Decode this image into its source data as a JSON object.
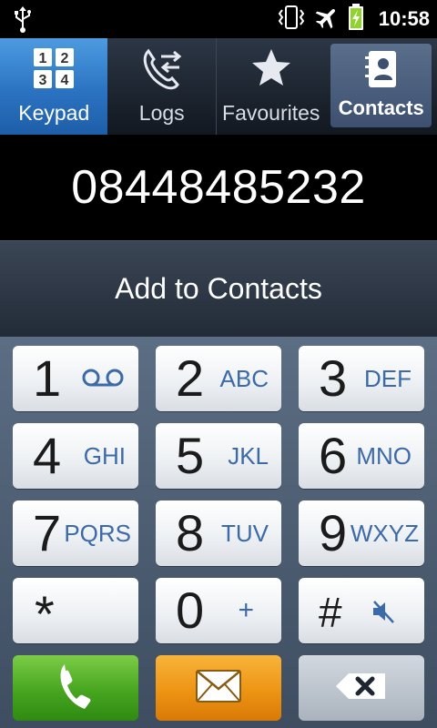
{
  "status": {
    "time": "10:58",
    "icons": [
      "usb-icon",
      "vibrate-icon",
      "airplane-icon",
      "battery-charging-icon"
    ]
  },
  "tabs": [
    {
      "label": "Keypad",
      "icon": "keypad-icon",
      "active": true
    },
    {
      "label": "Logs",
      "icon": "call-logs-icon",
      "active": false
    },
    {
      "label": "Favourites",
      "icon": "star-icon",
      "active": false
    },
    {
      "label": "Contacts",
      "icon": "contacts-icon",
      "active": false
    }
  ],
  "tab_keypad_icon_digits": [
    "1",
    "2",
    "3",
    "4"
  ],
  "dialed_number": "08448485232",
  "add_to_contacts_label": "Add to Contacts",
  "keys": [
    {
      "digit": "1",
      "letters": ""
    },
    {
      "digit": "2",
      "letters": "ABC"
    },
    {
      "digit": "3",
      "letters": "DEF"
    },
    {
      "digit": "4",
      "letters": "GHI"
    },
    {
      "digit": "5",
      "letters": "JKL"
    },
    {
      "digit": "6",
      "letters": "MNO"
    },
    {
      "digit": "7",
      "letters": "PQRS"
    },
    {
      "digit": "8",
      "letters": "TUV"
    },
    {
      "digit": "9",
      "letters": "WXYZ"
    },
    {
      "digit": "*",
      "letters": ""
    },
    {
      "digit": "0",
      "letters": "+"
    },
    {
      "digit": "#",
      "letters": ""
    }
  ],
  "colors": {
    "active_tab": "#2b73c2",
    "letters": "#3c6aa8",
    "call_button": "#47a520",
    "message_button": "#ee9414"
  }
}
